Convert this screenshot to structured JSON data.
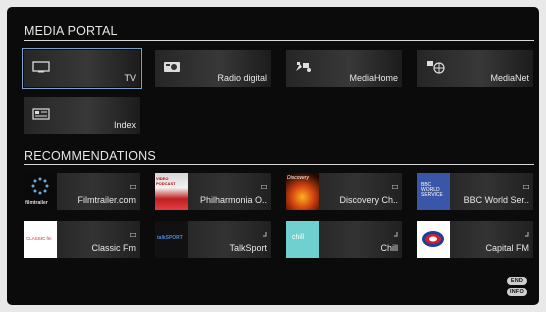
{
  "media_portal": {
    "title": "MEDIA PORTAL",
    "tiles": [
      {
        "label": "TV",
        "icon": "tv-icon",
        "selected": true
      },
      {
        "label": "Radio digital",
        "icon": "radio-icon"
      },
      {
        "label": "MediaHome",
        "icon": "mediahome-icon"
      },
      {
        "label": "MediaNet",
        "icon": "medianet-icon"
      },
      {
        "label": "Index",
        "icon": "index-icon"
      }
    ]
  },
  "recommendations": {
    "title": "RECOMMENDATIONS",
    "items": [
      {
        "label": "Filmtrailer.com",
        "thumb_text": "filmtrailer",
        "type": "video"
      },
      {
        "label": "Philharmonia O..",
        "thumb_text": "VIDEO PODCAST",
        "type": "video"
      },
      {
        "label": "Discovery Ch..",
        "thumb_text": "Discovery",
        "type": "video"
      },
      {
        "label": "BBC World Ser..",
        "thumb_text": "BBC WORLD SERVICE",
        "type": "video"
      },
      {
        "label": "Classic Fm",
        "thumb_text": "CLASSIC fm",
        "type": "video"
      },
      {
        "label": "TalkSport",
        "thumb_text": "talkSPORT",
        "type": "audio"
      },
      {
        "label": "Chill",
        "thumb_text": "chill",
        "type": "audio"
      },
      {
        "label": "Capital FM",
        "thumb_text": "",
        "type": "audio"
      }
    ]
  },
  "footer_buttons": {
    "end": "END",
    "info": "INFO"
  },
  "colors": {
    "selected_border": "#7fa0c8",
    "background": "#0b0b0b"
  }
}
